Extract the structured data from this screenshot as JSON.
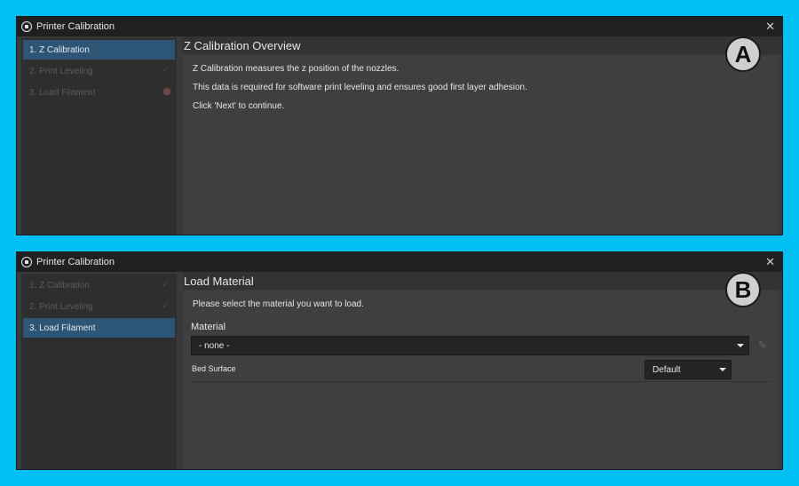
{
  "windows": [
    {
      "title": "Printer Calibration",
      "steps": [
        {
          "label": "1. Z Calibration",
          "active": true
        },
        {
          "label": "2. Print Leveling",
          "status": "✓"
        },
        {
          "label": "3. Load Filament"
        }
      ],
      "page_title": "Z Calibration Overview",
      "paragraphs": [
        "Z Calibration measures the z position of the nozzles.",
        "This data is required for software print leveling and ensures good first layer adhesion.",
        "Click 'Next' to continue."
      ],
      "badge": "A"
    },
    {
      "title": "Printer Calibration",
      "steps": [
        {
          "label": "1. Z Calibration",
          "status": "✓"
        },
        {
          "label": "2. Print Leveling",
          "status": "✓"
        },
        {
          "label": "3. Load Filament",
          "active": true
        }
      ],
      "page_title": "Load Material",
      "instruction": "Please select the material you want to load.",
      "material_label": "Material",
      "material_value": "- none -",
      "bed_surface_label": "Bed Surface",
      "bed_surface_value": "Default",
      "badge": "B"
    }
  ],
  "colors": {
    "background": "#00bff3",
    "active_step": "#2d5576",
    "window": "#3a3a3a"
  },
  "icons": {
    "app": "printer-calibration-icon",
    "close": "close-icon",
    "edit": "pencil-icon",
    "status": "check-icon",
    "warning": "warning-icon"
  }
}
